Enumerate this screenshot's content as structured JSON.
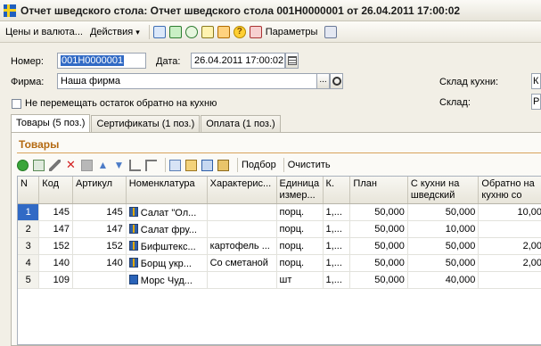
{
  "window": {
    "title": "Отчет шведского стола: Отчет шведского стола 001Н0000001 от 26.04.2011 17:00:02"
  },
  "toolbar": {
    "prices_label": "Цены и валюта...",
    "actions_label": "Действия",
    "actions_arrow": "▾",
    "params_label": "Параметры",
    "help_glyph": "?"
  },
  "form": {
    "number_label": "Номер:",
    "number_value": "001Н0000001",
    "date_label": "Дата:",
    "date_value": "26.04.2011 17:00:02",
    "firm_label": "Фирма:",
    "firm_value": "Наша фирма",
    "firm_dots": "...",
    "no_return_label": "Не перемещать остаток обратно на кухню",
    "kitchen_wh_label": "Склад кухни:",
    "kitchen_wh_value": "К",
    "wh_label": "Склад:",
    "wh_value": "Р"
  },
  "tabs": [
    {
      "label": "Товары (5 поз.)"
    },
    {
      "label": "Сертификаты (1 поз.)"
    },
    {
      "label": "Оплата (1 поз.)"
    }
  ],
  "section": {
    "title": "Товары"
  },
  "grid_toolbar": {
    "selection_label": "Подбор",
    "clear_label": "Очистить"
  },
  "table": {
    "columns": [
      "N",
      "Код",
      "Артикул",
      "Номенклатура",
      "Характерис...",
      "Единица измер...",
      "К.",
      "План",
      "С кухни на шведский",
      "Обратно на кухню со"
    ],
    "rows": [
      [
        "1",
        "145",
        "145",
        "Салат \"Ол...",
        "",
        "порц.",
        "1,...",
        "50,000",
        "50,000",
        "10,00"
      ],
      [
        "2",
        "147",
        "147",
        "Салат фру...",
        "",
        "порц.",
        "1,...",
        "50,000",
        "10,000",
        ""
      ],
      [
        "3",
        "152",
        "152",
        "Бифштекс...",
        "картофель ...",
        "порц.",
        "1,...",
        "50,000",
        "50,000",
        "2,00"
      ],
      [
        "4",
        "140",
        "140",
        "Борщ укр...",
        "Со сметаной",
        "порц.",
        "1,...",
        "50,000",
        "50,000",
        "2,00"
      ],
      [
        "5",
        "109",
        "",
        "Морс Чуд...",
        "",
        "шт",
        "1,...",
        "50,000",
        "40,000",
        ""
      ]
    ]
  },
  "colors": {
    "accent": "#316ac5",
    "section_title": "#b46a12"
  }
}
